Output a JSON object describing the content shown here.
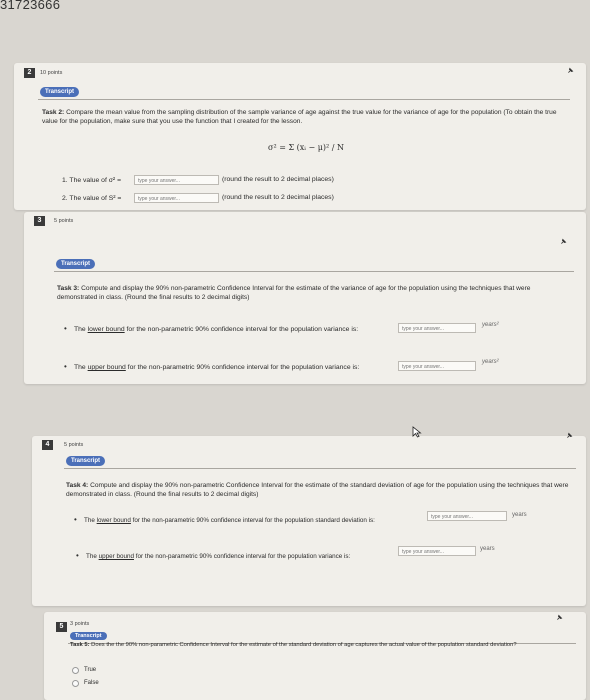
{
  "header": {
    "id_text": "31723666"
  },
  "questions": [
    {
      "number": "2",
      "points": "10 points",
      "pill": "Transcript",
      "task_bold": "Task 2:",
      "task_text": " Compare the mean value from the sampling distribution of the sample variance of age against the true value for the variance of age for the population (To obtain the true value for the population, make sure that you use the function that I created for the lesson.",
      "formula": "σ² = Σ (xᵢ − μ)² / N",
      "rows": [
        {
          "label": "1. The value of σ² =",
          "placeholder": "type your answer...",
          "note": "(round the result to 2 decimal places)"
        },
        {
          "label": "2. The value of S² =",
          "placeholder": "type your answer...",
          "note": "(round the result to 2 decimal places)"
        }
      ]
    },
    {
      "number": "3",
      "points": "5 points",
      "pill": "Transcript",
      "task_bold": "Task 3:",
      "task_text": " Compute and display the 90% non-parametric Confidence Interval for the estimate of the variance of age for the population using the techniques that were demonstrated in class. (Round the final results to 2 decimal digits)",
      "bullets": [
        {
          "pre": "The ",
          "u": "lower bound",
          "post": " for the non-parametric 90% confidence interval for the population variance is:",
          "placeholder": "type your answer...",
          "unit": "years²"
        },
        {
          "pre": "The ",
          "u": "upper bound",
          "post": " for the non-parametric 90% confidence interval for the population variance is:",
          "placeholder": "type your answer...",
          "unit": "years²"
        }
      ]
    },
    {
      "number": "4",
      "points": "5 points",
      "pill": "Transcript",
      "task_bold": "Task 4:",
      "task_text": " Compute and display the 90% non-parametric Confidence Interval for the estimate of the standard deviation of age for the population using the techniques that were demonstrated in class. (Round the final results to 2 decimal digits)",
      "bullets": [
        {
          "pre": "The ",
          "u": "lower bound",
          "post": " for the non-parametric 90% confidence interval for the population standard deviation is:",
          "placeholder": "type your answer...",
          "unit": "years"
        },
        {
          "pre": "The ",
          "u": "upper bound",
          "post": " for the non-parametric 90% confidence interval for the population variance is:",
          "placeholder": "type your answer...",
          "unit": "years"
        }
      ]
    },
    {
      "number": "5",
      "points": "3 points",
      "pill": "Transcript",
      "task_bold": "Task 5:",
      "task_text": " Does the the 90% non-parametric Confidence Interval for the estimate of the standard deviation of age captures the actual value of the population standard deviation?",
      "options": [
        "True",
        "False"
      ]
    }
  ]
}
